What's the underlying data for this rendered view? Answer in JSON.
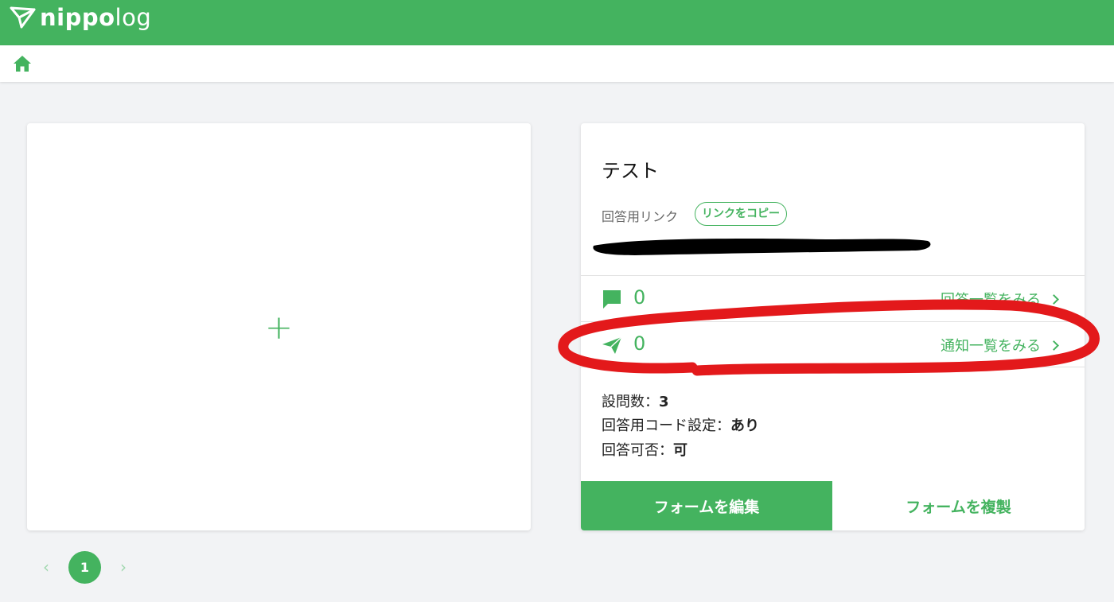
{
  "app": {
    "logo_bold": "nippo",
    "logo_light": "log"
  },
  "new_card": {
    "plus": "+"
  },
  "form": {
    "title": "テスト",
    "link_label": "回答用リンク",
    "copy_label": "リンクをコピー",
    "responses": {
      "count": "0",
      "link_label": "回答一覧をみる"
    },
    "notifications": {
      "count": "0",
      "link_label": "通知一覧をみる"
    },
    "meta": [
      {
        "label": "設問数：",
        "value": "3"
      },
      {
        "label": "回答用コード設定：",
        "value": "あり"
      },
      {
        "label": "回答可否：",
        "value": "可"
      }
    ],
    "edit_label": "フォームを編集",
    "duplicate_label": "フォームを複製"
  },
  "pagination": {
    "prev": "‹",
    "current": "1",
    "next": "›"
  },
  "colors": {
    "brand": "#44b35f",
    "annotation": "#e3191b"
  }
}
